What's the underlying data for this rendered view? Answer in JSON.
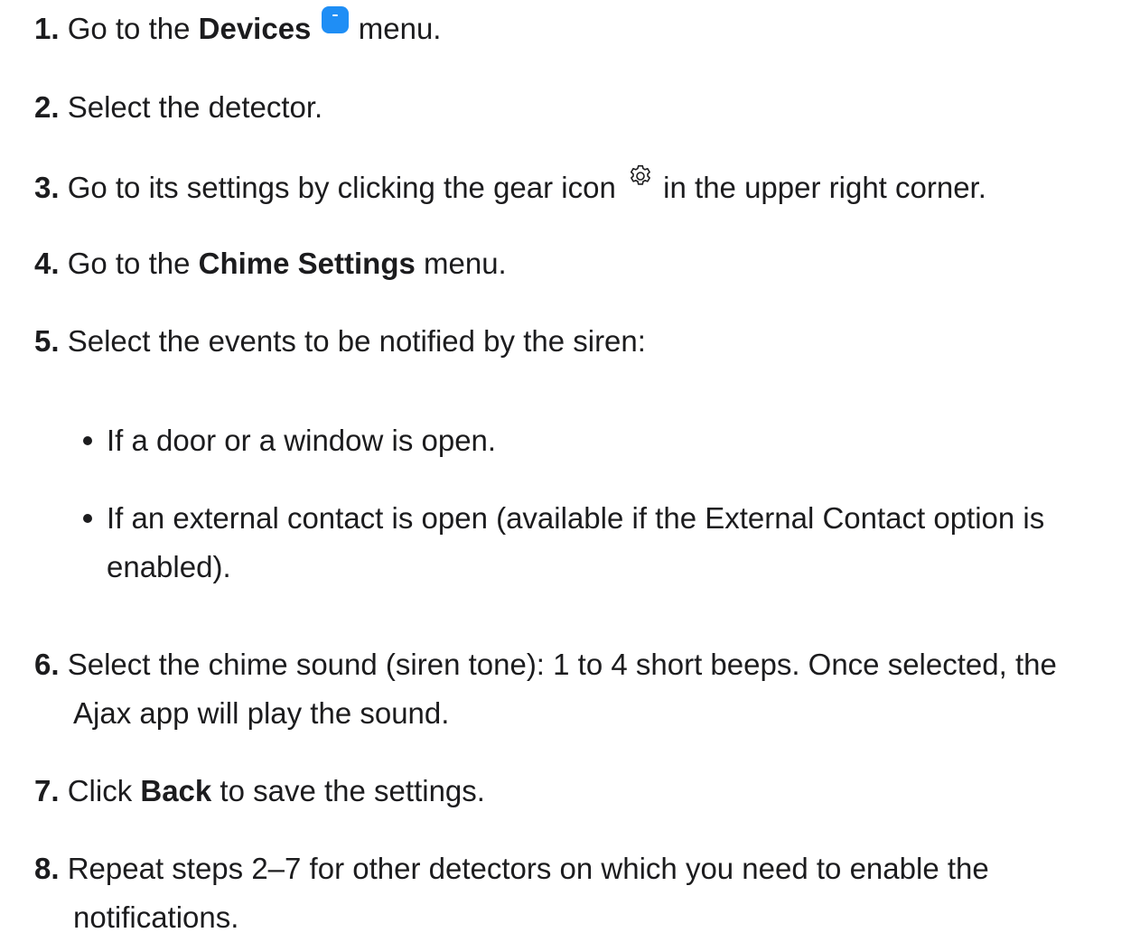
{
  "steps": [
    {
      "num": "1.",
      "pre": "Go to the ",
      "bold": "Devices",
      "post": " menu.",
      "icon": "devices-icon"
    },
    {
      "num": "2.",
      "text": "Select the detector."
    },
    {
      "num": "3.",
      "pre": "Go to its settings by clicking the gear icon ",
      "post": " in the upper right corner.",
      "icon": "gear-icon"
    },
    {
      "num": "4.",
      "pre": "Go to the ",
      "bold": "Chime Settings",
      "post": " menu."
    },
    {
      "num": "5.",
      "text": "Select the events to be notified by the siren:"
    },
    {
      "num": "6.",
      "line1": "Select the chime sound (siren tone): 1 to 4 short beeps. Once selected, the",
      "line2": "Ajax app will play the sound."
    },
    {
      "num": "7.",
      "pre": "Click ",
      "bold": "Back",
      "post": " to save the settings."
    },
    {
      "num": "8.",
      "line1": "Repeat steps 2–7 for other detectors on which you need to enable the",
      "line2": "notifications."
    }
  ],
  "bullets": [
    {
      "line1": "If a door or a window is open."
    },
    {
      "line1": "If an external contact is open (available if the External Contact option is",
      "line2": "enabled)."
    }
  ],
  "colors": {
    "text": "#1c1c1e",
    "devices_icon": "#1f8ef5"
  }
}
